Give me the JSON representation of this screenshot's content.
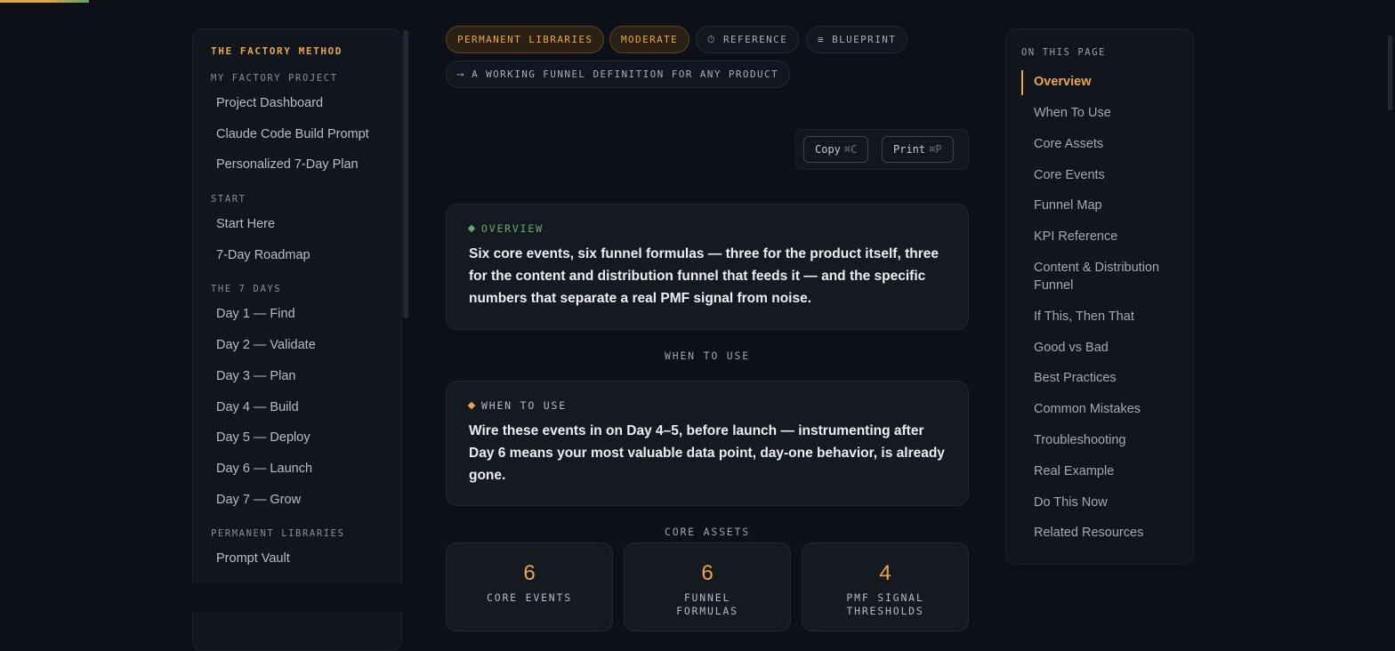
{
  "sidebar": {
    "brand": "THE FACTORY METHOD",
    "sections": [
      {
        "title": "MY FACTORY PROJECT",
        "items": [
          "Project Dashboard",
          "Claude Code Build Prompt",
          "Personalized 7-Day Plan"
        ]
      },
      {
        "title": "START",
        "items": [
          "Start Here",
          "7-Day Roadmap"
        ]
      },
      {
        "title": "THE 7 DAYS",
        "items": [
          "Day 1 — Find",
          "Day 2 — Validate",
          "Day 3 — Plan",
          "Day 4 — Build",
          "Day 5 — Deploy",
          "Day 6 — Launch",
          "Day 7 — Grow"
        ]
      },
      {
        "title": "PERMANENT LIBRARIES",
        "items": [
          "Prompt Vault"
        ]
      }
    ]
  },
  "tags": {
    "library": "PERMANENT LIBRARIES",
    "level": "MODERATE",
    "reference": "REFERENCE",
    "blueprint": "BLUEPRINT",
    "subtitle": "A WORKING FUNNEL DEFINITION FOR ANY PRODUCT"
  },
  "actions": {
    "copy_label": "Copy",
    "copy_shortcut": "⌘C",
    "print_label": "Print",
    "print_shortcut": "⌘P"
  },
  "overview": {
    "label": "OVERVIEW",
    "body": "Six core events, six funnel formulas — three for the product itself, three for the content and distribution funnel that feeds it — and the specific numbers that separate a real PMF signal from noise."
  },
  "when_to_use": {
    "divider": "WHEN TO USE",
    "label": "WHEN TO USE",
    "body": "Wire these events in on Day 4–5, before launch — instrumenting after Day 6 means your most valuable data point, day-one behavior, is already gone."
  },
  "core_assets": {
    "divider": "CORE ASSETS",
    "stats": [
      {
        "value": "6",
        "caption": "CORE EVENTS"
      },
      {
        "value": "6",
        "caption": "FUNNEL FORMULAS"
      },
      {
        "value": "4",
        "caption": "PMF SIGNAL THRESHOLDS"
      }
    ]
  },
  "toc": {
    "title": "ON THIS PAGE",
    "items": [
      "Overview",
      "When To Use",
      "Core Assets",
      "Core Events",
      "Funnel Map",
      "KPI Reference",
      "Content & Distribution Funnel",
      "If This, Then That",
      "Good vs Bad",
      "Best Practices",
      "Common Mistakes",
      "Troubleshooting",
      "Real Example",
      "Do This Now",
      "Related Resources"
    ]
  },
  "colors": {
    "accent": "#e8a64e",
    "green": "#5fa06a",
    "background": "#0d1016"
  }
}
